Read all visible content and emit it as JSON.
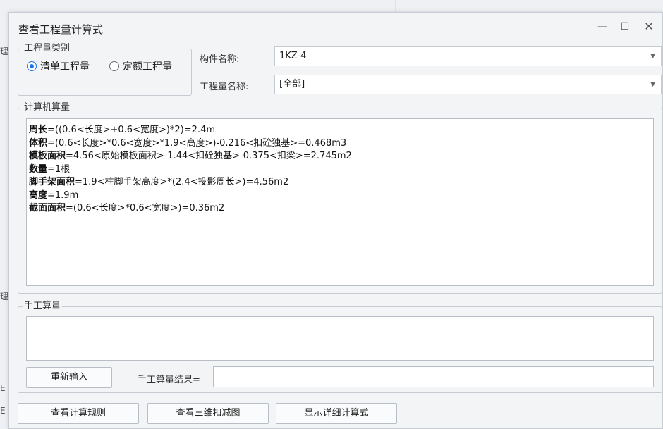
{
  "background": {
    "side_labels": [
      "理",
      "理",
      "E",
      "E"
    ]
  },
  "dialog": {
    "title": "查看工程量计算式",
    "controls": {
      "minimize": "—",
      "maximize": "☐",
      "close": "✕"
    },
    "quantity_type": {
      "legend": "工程量类别",
      "options": [
        {
          "label": "清单工程量",
          "checked": true
        },
        {
          "label": "定额工程量",
          "checked": false
        }
      ]
    },
    "component_name": {
      "label": "构件名称:",
      "value": "1KZ-4"
    },
    "quantity_name": {
      "label": "工程量名称:",
      "value": "[全部]"
    },
    "computer_calc": {
      "legend": "计算机算量",
      "lines": [
        {
          "name": "周长",
          "expr": "=((0.6<长度>+0.6<宽度>)*2)=2.4m"
        },
        {
          "name": "体积",
          "expr": "=(0.6<长度>*0.6<宽度>*1.9<高度>)-0.216<扣砼独基>=0.468m3"
        },
        {
          "name": "模板面积",
          "expr": "=4.56<原始模板面积>-1.44<扣砼独基>-0.375<扣梁>=2.745m2"
        },
        {
          "name": "数量",
          "expr": "=1根"
        },
        {
          "name": "脚手架面积",
          "expr": "=1.9<柱脚手架高度>*(2.4<投影周长>)=4.56m2"
        },
        {
          "name": "高度",
          "expr": "=1.9m"
        },
        {
          "name": "截面面积",
          "expr": "=(0.6<长度>*0.6<宽度>)=0.36m2"
        }
      ]
    },
    "manual_calc": {
      "legend": "手工算量",
      "reinput_button": "重新输入",
      "result_label": "手工算量结果=",
      "result_value": ""
    },
    "footer_buttons": {
      "rules": "查看计算规则",
      "deduction_3d": "查看三维扣减图",
      "detailed": "显示详细计算式"
    }
  }
}
